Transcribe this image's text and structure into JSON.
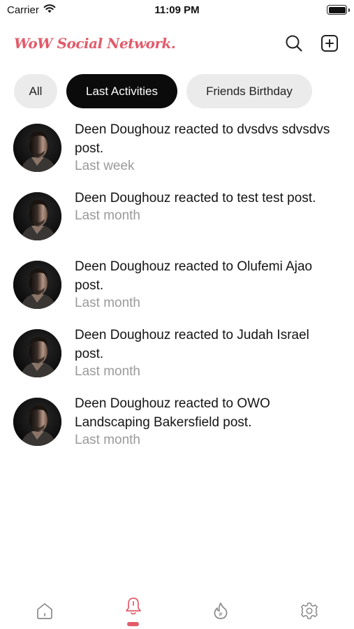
{
  "status_bar": {
    "carrier": "Carrier",
    "time": "11:09 PM"
  },
  "header": {
    "logo_text": "WoW Social Network.",
    "brand_color": "#e25b6a",
    "search_icon": "search-icon",
    "add_icon": "plus-square-icon"
  },
  "tabs": [
    {
      "label": "All",
      "active": false
    },
    {
      "label": "Last Activities",
      "active": true
    },
    {
      "label": "Friends Birthday",
      "active": false
    }
  ],
  "activities": [
    {
      "message": "Deen Doughouz reacted to dvsdvs sdvsdvs post.",
      "time": "Last week"
    },
    {
      "message": "Deen Doughouz reacted to test test post.",
      "time": "Last month"
    },
    {
      "message": "Deen Doughouz reacted to Olufemi Ajao post.",
      "time": "Last month"
    },
    {
      "message": "Deen Doughouz reacted to Judah Israel post.",
      "time": "Last month"
    },
    {
      "message": "Deen Doughouz reacted to OWO Landscaping Bakersfield post.",
      "time": "Last month"
    }
  ],
  "bottom_nav": {
    "items": [
      "home-icon",
      "bell-icon",
      "hashtag-flame-icon",
      "gear-icon"
    ],
    "active": "bell-icon",
    "active_color": "#e25b6a",
    "inactive_color": "#8a8a8a"
  }
}
